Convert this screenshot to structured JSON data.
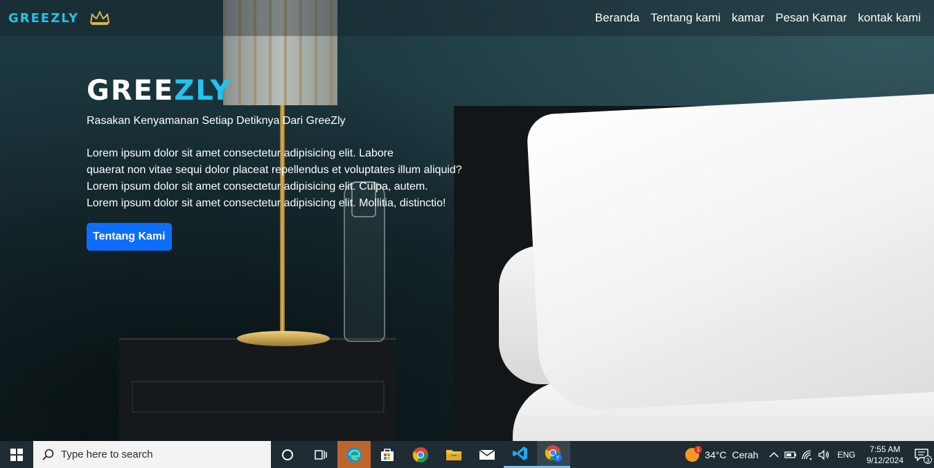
{
  "navbar": {
    "brand": "GREEZLY",
    "links": [
      "Beranda",
      "Tentang kami",
      "kamar",
      "Pesan Kamar",
      "kontak kami"
    ]
  },
  "hero": {
    "title_part1": "GREE",
    "title_part2": "ZLY",
    "tagline": "Rasakan Kenyamanan Setiap Detiknya Dari GreeZly",
    "paragraph_lines": [
      "Lorem ipsum dolor sit amet consectetur adipisicing elit. Labore",
      "quaerat non vitae sequi dolor placeat repellendus et voluptates illum aliquid?",
      "Lorem ipsum dolor sit amet consectetur adipisicing elit. Culpa, autem.",
      "Lorem ipsum dolor sit amet consectetur adipisicing elit. Mollitia, distinctio!"
    ],
    "button_label": "Tentang Kami"
  },
  "taskbar": {
    "search_placeholder": "Type here to search",
    "weather_temp": "34°C",
    "weather_desc": "Cerah",
    "weather_badge": "1",
    "language": "ENG",
    "time": "7:55 AM",
    "date": "9/12/2024",
    "notification_count": "3"
  },
  "colors": {
    "brand_blue": "#1fc4f1",
    "button_blue": "#0d6efd",
    "taskbar": "#1f2c34"
  }
}
